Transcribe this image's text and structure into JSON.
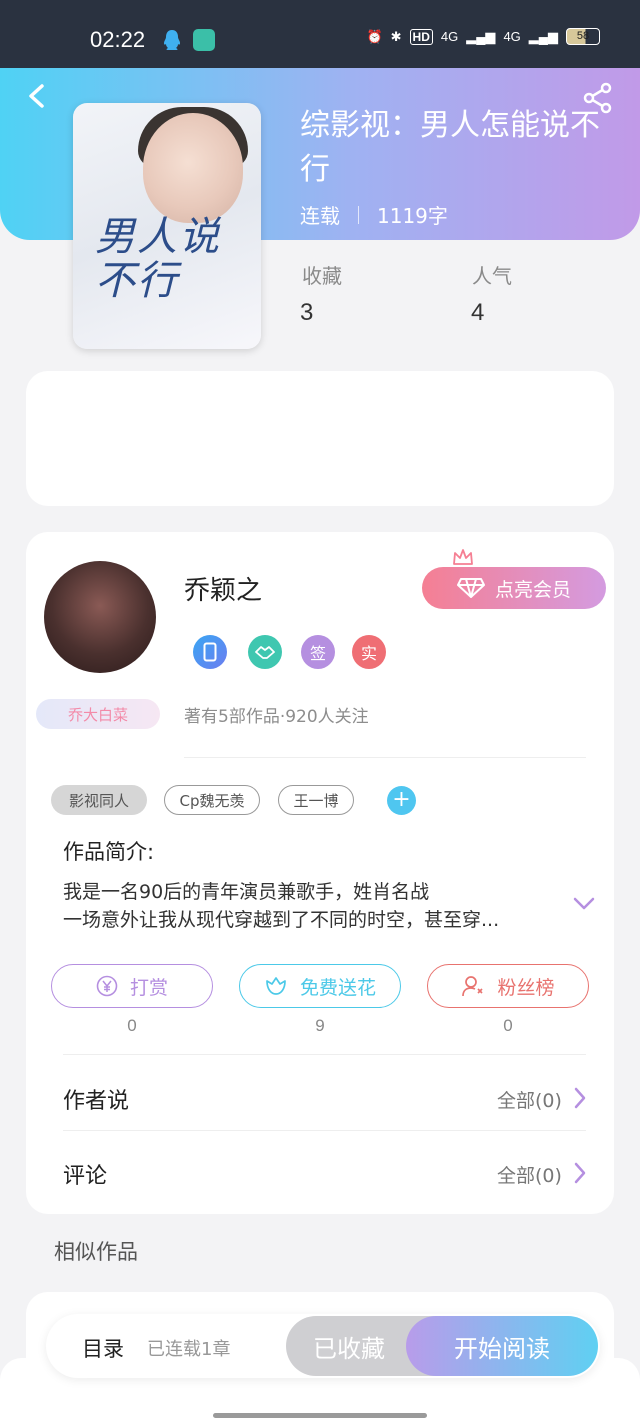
{
  "status_bar": {
    "time": "02:22",
    "network_hd": "HD",
    "network_4g_1": "4G",
    "network_4g_2": "4G",
    "battery": "58"
  },
  "book": {
    "title": "综影视：男人怎能说不行",
    "status": "连载",
    "word_count": "1119字",
    "cover_text": "男人说不行",
    "favorites_label": "收藏",
    "favorites_value": "3",
    "popularity_label": "人气",
    "popularity_value": "4"
  },
  "author": {
    "name": "乔颖之",
    "vip_button": "点亮会员",
    "badges": [
      "签",
      "实"
    ],
    "nickname_tag": "乔大白菜",
    "stats": "著有5部作品·920人关注"
  },
  "tags": [
    "影视同人",
    "Cp魏无羡",
    "王一博"
  ],
  "intro": {
    "title": "作品简介:",
    "line1": "我是一名90后的青年演员兼歌手，姓肖名战",
    "line2": "一场意外让我从现代穿越到了不同的时空，甚至穿..."
  },
  "actions": {
    "reward": {
      "label": "打赏",
      "count": "0"
    },
    "flowers": {
      "label": "免费送花",
      "count": "9"
    },
    "fans": {
      "label": "粉丝榜",
      "count": "0"
    }
  },
  "rows": {
    "author_says": {
      "label": "作者说",
      "right": "全部(0)"
    },
    "comments": {
      "label": "评论",
      "right": "全部(0)"
    }
  },
  "similar_title": "相似作品",
  "bottom_bar": {
    "toc": "目录",
    "toc_sub": "已连载1章",
    "collected": "已收藏",
    "start_reading": "开始阅读"
  },
  "colors": {
    "accent_cyan": "#4fd2f4",
    "accent_purple": "#c19ae8",
    "vip_pink": "#f57f93",
    "reward_purple": "#b58fe0",
    "flower_cyan": "#4cc9e8",
    "fans_red": "#e8736f"
  }
}
